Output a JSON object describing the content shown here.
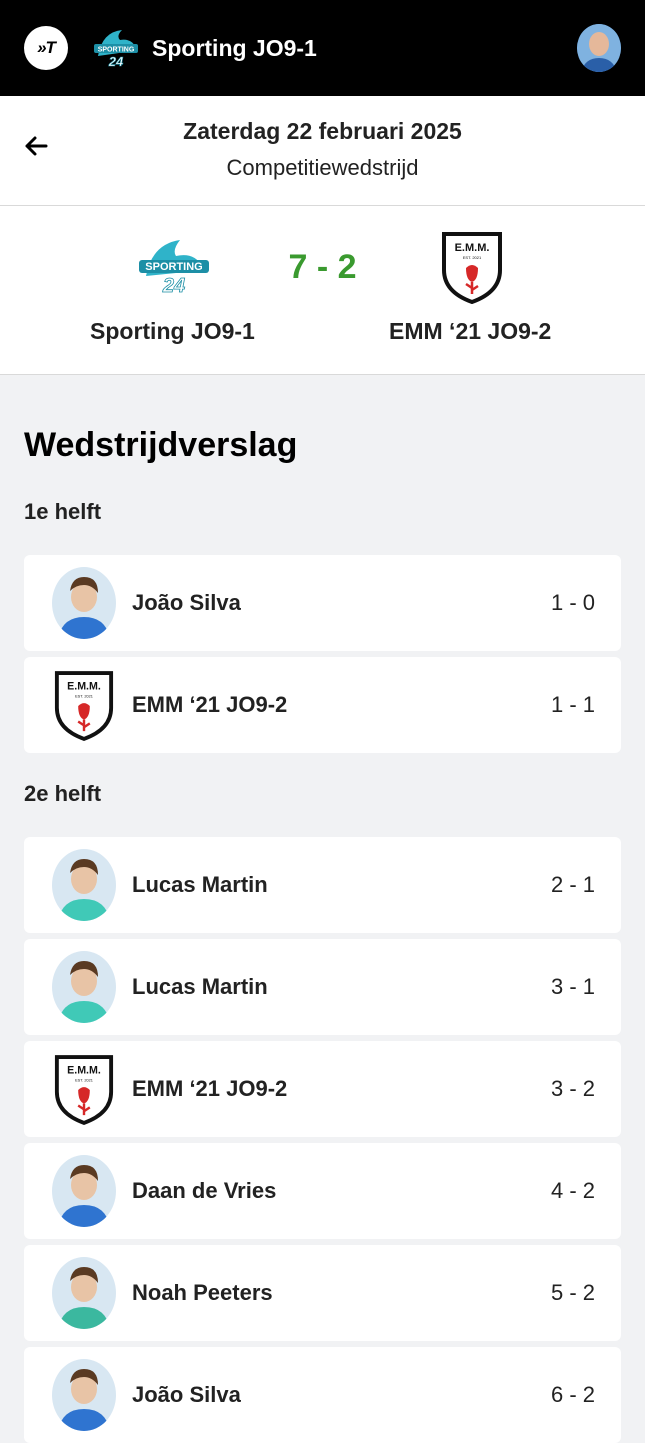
{
  "app": {
    "logo_text": "»T"
  },
  "header": {
    "team_name": "Sporting JO9-1",
    "team_logo_text_1": "SPORTING",
    "team_logo_text_2": "24"
  },
  "match": {
    "date": "Zaterdag 22 februari 2025",
    "type": "Competitiewedstrijd",
    "home_team": "Sporting JO9-1",
    "away_team": "EMM ‘21 JO9-2",
    "score": "7 - 2",
    "away_crest_text": "E.M.M.",
    "away_crest_est": "EST. 2021"
  },
  "report": {
    "title": "Wedstrijdverslag",
    "halves": [
      {
        "label": "1e helft"
      },
      {
        "label": "2e helft"
      }
    ],
    "events": [
      {
        "name": "João Silva",
        "score": "1 - 0",
        "type": "player",
        "shirt": "#2f74d0"
      },
      {
        "name": "EMM ‘21 JO9-2",
        "score": "1 - 1",
        "type": "team"
      },
      {
        "name": "Lucas Martin",
        "score": "2 - 1",
        "type": "player",
        "shirt": "#40c9b7"
      },
      {
        "name": "Lucas Martin",
        "score": "3 - 1",
        "type": "player",
        "shirt": "#40c9b7"
      },
      {
        "name": "EMM ‘21 JO9-2",
        "score": "3 - 2",
        "type": "team"
      },
      {
        "name": "Daan de Vries",
        "score": "4 - 2",
        "type": "player",
        "shirt": "#2f74d0"
      },
      {
        "name": "Noah Peeters",
        "score": "5 - 2",
        "type": "player",
        "shirt": "#3bb89f"
      },
      {
        "name": "João Silva",
        "score": "6 - 2",
        "type": "player",
        "shirt": "#2f74d0"
      }
    ]
  },
  "colors": {
    "score_green": "#3a9a2f",
    "topbar": "#000000",
    "crest_red": "#d62828"
  }
}
